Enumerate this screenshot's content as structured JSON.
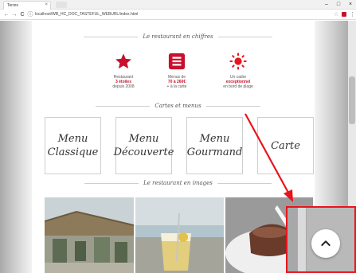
{
  "browser": {
    "tab_title": "Terres",
    "tab_close": "×",
    "url": "localhost/WB_HC_DOC_TASTEFUL_WEBURL/index.html",
    "minimize": "–",
    "maximize": "□",
    "close": "×",
    "back": "←",
    "forward": "→",
    "reload": "C",
    "info": "ⓘ",
    "star": "☆",
    "menu": "⋮"
  },
  "sections": {
    "figures_title": "Le restaurant en chiffres",
    "cards_title": "Cartes et menus",
    "images_title": "Le restaurant en images"
  },
  "features": [
    {
      "icon": "star-icon",
      "line1": "Restaurant",
      "highlight": "3 étoiles",
      "line3": "depuis 2008"
    },
    {
      "icon": "menu-list-icon",
      "line1": "Menus de",
      "highlight": "70 à 260€",
      "line3": "+ à la carte"
    },
    {
      "icon": "sun-icon",
      "line1": "Un cadre",
      "highlight": "exceptionnel",
      "line3": "en bord de plage"
    }
  ],
  "cards": [
    {
      "line1": "Menu",
      "line2": "Classique"
    },
    {
      "line1": "Menu",
      "line2": "Découverte"
    },
    {
      "line1": "Menu",
      "line2": "Gourmand"
    },
    {
      "line1": "Carte",
      "line2": ""
    }
  ],
  "colors": {
    "accent": "#c8102e",
    "annotation": "#e8141c"
  },
  "annotation": {
    "target_icon": "chevron-up-icon"
  }
}
